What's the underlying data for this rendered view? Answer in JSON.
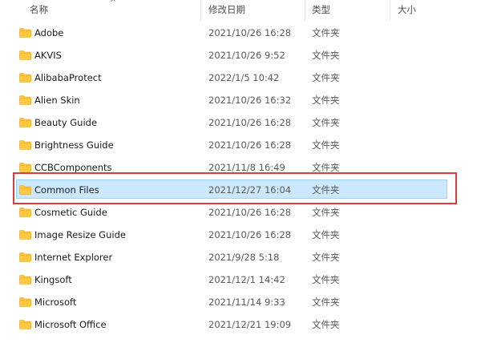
{
  "header": {
    "name": "名称",
    "date": "修改日期",
    "type": "类型",
    "size": "大小"
  },
  "colors": {
    "folder": "#ffc83d",
    "selection_bg": "#cce8ff",
    "selection_border": "#99d1ff",
    "highlight_box": "#e03a3a"
  },
  "rows": [
    {
      "name": "Adobe",
      "date": "2021/10/26 16:28",
      "type": "文件夹",
      "icon": "folder-icon"
    },
    {
      "name": "AKVIS",
      "date": "2021/10/26 9:52",
      "type": "文件夹",
      "icon": "folder-icon"
    },
    {
      "name": "AlibabaProtect",
      "date": "2022/1/5 10:42",
      "type": "文件夹",
      "icon": "folder-icon"
    },
    {
      "name": "Alien Skin",
      "date": "2021/10/26 16:32",
      "type": "文件夹",
      "icon": "folder-icon"
    },
    {
      "name": "Beauty Guide",
      "date": "2021/10/26 16:28",
      "type": "文件夹",
      "icon": "folder-icon"
    },
    {
      "name": "Brightness Guide",
      "date": "2021/10/26 16:28",
      "type": "文件夹",
      "icon": "folder-icon"
    },
    {
      "name": "CCBComponents",
      "date": "2021/11/8 16:49",
      "type": "文件夹",
      "icon": "folder-icon"
    },
    {
      "name": "Common Files",
      "date": "2021/12/27 16:04",
      "type": "文件夹",
      "icon": "folder-icon",
      "selected": true
    },
    {
      "name": "Cosmetic Guide",
      "date": "2021/10/26 16:28",
      "type": "文件夹",
      "icon": "folder-icon"
    },
    {
      "name": "Image Resize Guide",
      "date": "2021/10/26 16:28",
      "type": "文件夹",
      "icon": "folder-icon"
    },
    {
      "name": "Internet Explorer",
      "date": "2021/9/28 5:18",
      "type": "文件夹",
      "icon": "folder-icon"
    },
    {
      "name": "Kingsoft",
      "date": "2021/12/1 14:42",
      "type": "文件夹",
      "icon": "folder-icon"
    },
    {
      "name": "Microsoft",
      "date": "2021/11/14 9:33",
      "type": "文件夹",
      "icon": "folder-icon"
    },
    {
      "name": "Microsoft Office",
      "date": "2021/12/21 19:09",
      "type": "文件夹",
      "icon": "folder-icon"
    }
  ]
}
